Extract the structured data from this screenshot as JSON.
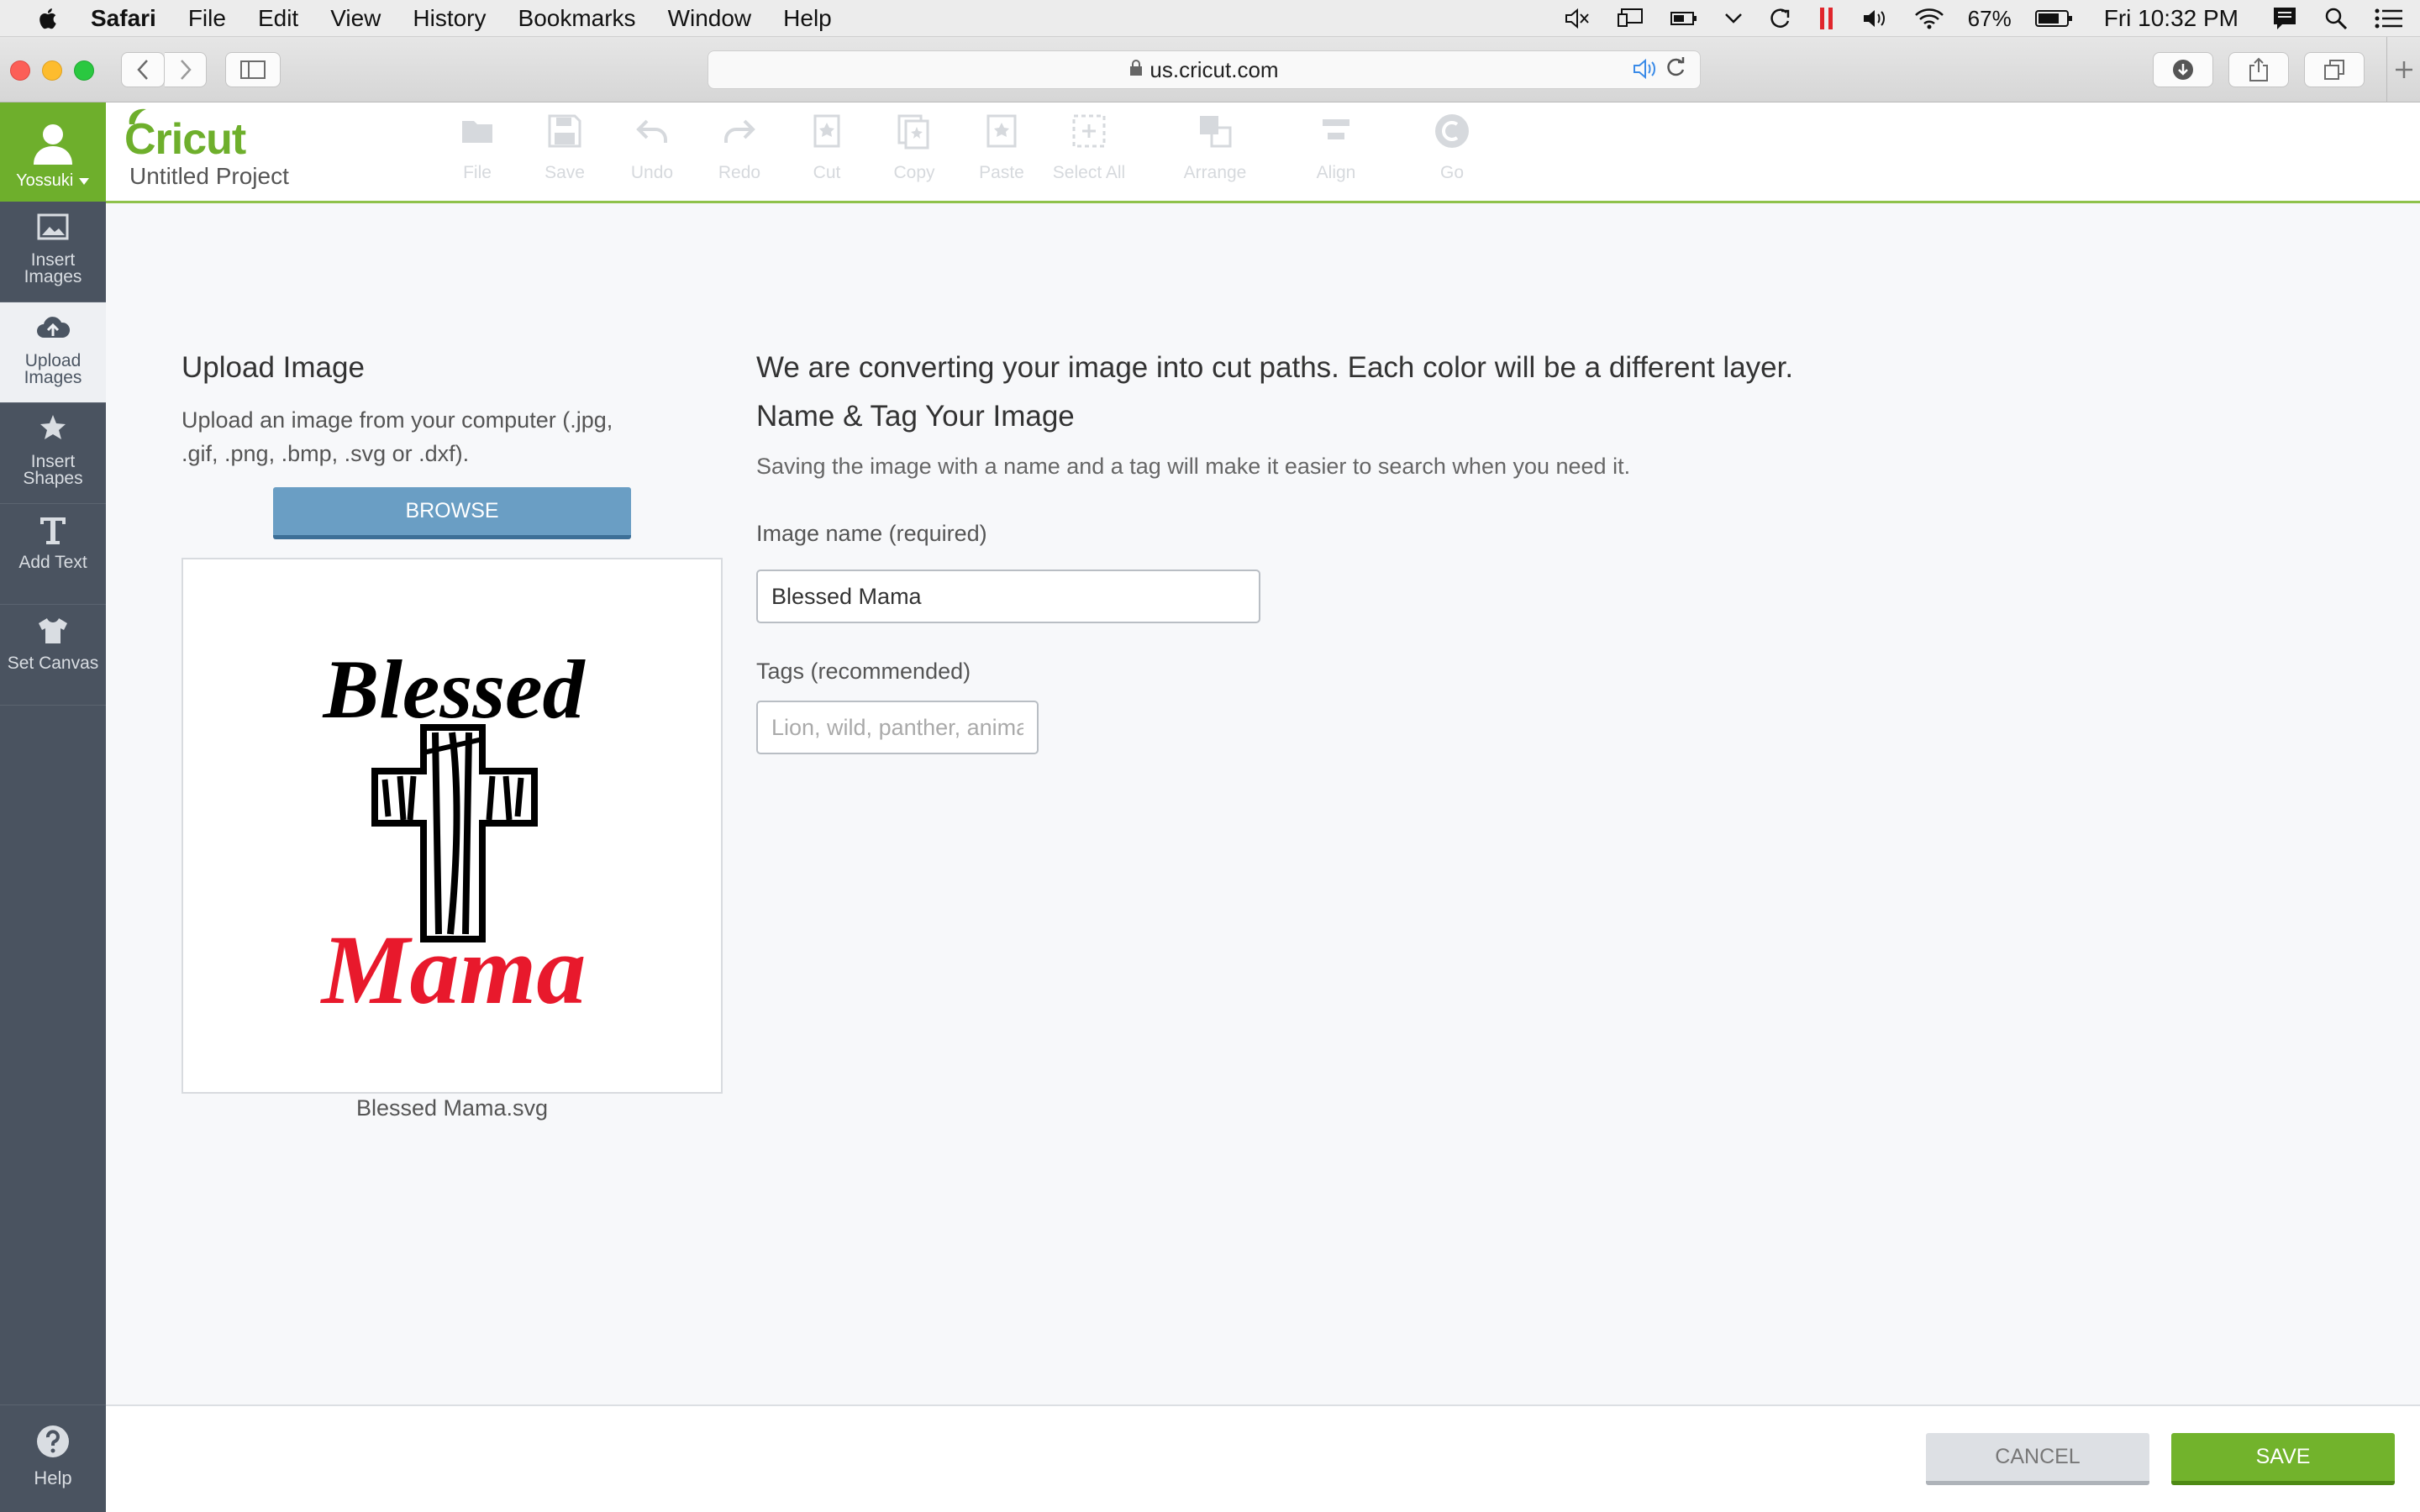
{
  "menubar": {
    "app_name": "Safari",
    "items": [
      "File",
      "Edit",
      "View",
      "History",
      "Bookmarks",
      "Window",
      "Help"
    ],
    "battery": "67%",
    "clock": "Fri 10:32 PM"
  },
  "browser": {
    "url": "us.cricut.com"
  },
  "sidebar": {
    "username": "Yossuki",
    "items": [
      {
        "label_line1": "Insert",
        "label_line2": "Images",
        "icon": "image-icon"
      },
      {
        "label_line1": "Upload",
        "label_line2": "Images",
        "icon": "cloud-upload-icon"
      },
      {
        "label_line1": "Insert",
        "label_line2": "Shapes",
        "icon": "shapes-icon"
      },
      {
        "label_line1": "Add Text",
        "label_line2": "",
        "icon": "text-icon"
      },
      {
        "label_line1": "Set Canvas",
        "label_line2": "",
        "icon": "shirt-icon"
      }
    ],
    "help_label": "Help"
  },
  "header": {
    "logo": "Cricut",
    "project_name": "Untitled Project",
    "tools": [
      "File",
      "Save",
      "Undo",
      "Redo",
      "Cut",
      "Copy",
      "Paste",
      "Select All",
      "Arrange",
      "Align",
      "Go"
    ]
  },
  "upload": {
    "title": "Upload Image",
    "description": "Upload an image from your computer (.jpg, .gif, .png, .bmp, .svg or .dxf).",
    "browse_label": "BROWSE",
    "preview_text_top": "Blessed",
    "preview_text_bottom": "Mama",
    "file_name": "Blessed Mama.svg"
  },
  "form": {
    "convert_message": "We are converting your image into cut paths. Each color will be a different layer.",
    "title": "Name & Tag Your Image",
    "description": "Saving the image with a name and a tag will make it easier to search when you need it.",
    "name_label": "Image name (required)",
    "name_value": "Blessed Mama",
    "tags_label": "Tags (recommended)",
    "tags_placeholder": "Lion, wild, panther, animal"
  },
  "footer": {
    "cancel_label": "CANCEL",
    "save_label": "SAVE"
  },
  "colors": {
    "brand_green": "#6eaf2c",
    "sidebar_bg": "#4a5360",
    "browse_blue": "#6a9ec4",
    "preview_red": "#e8192c"
  }
}
